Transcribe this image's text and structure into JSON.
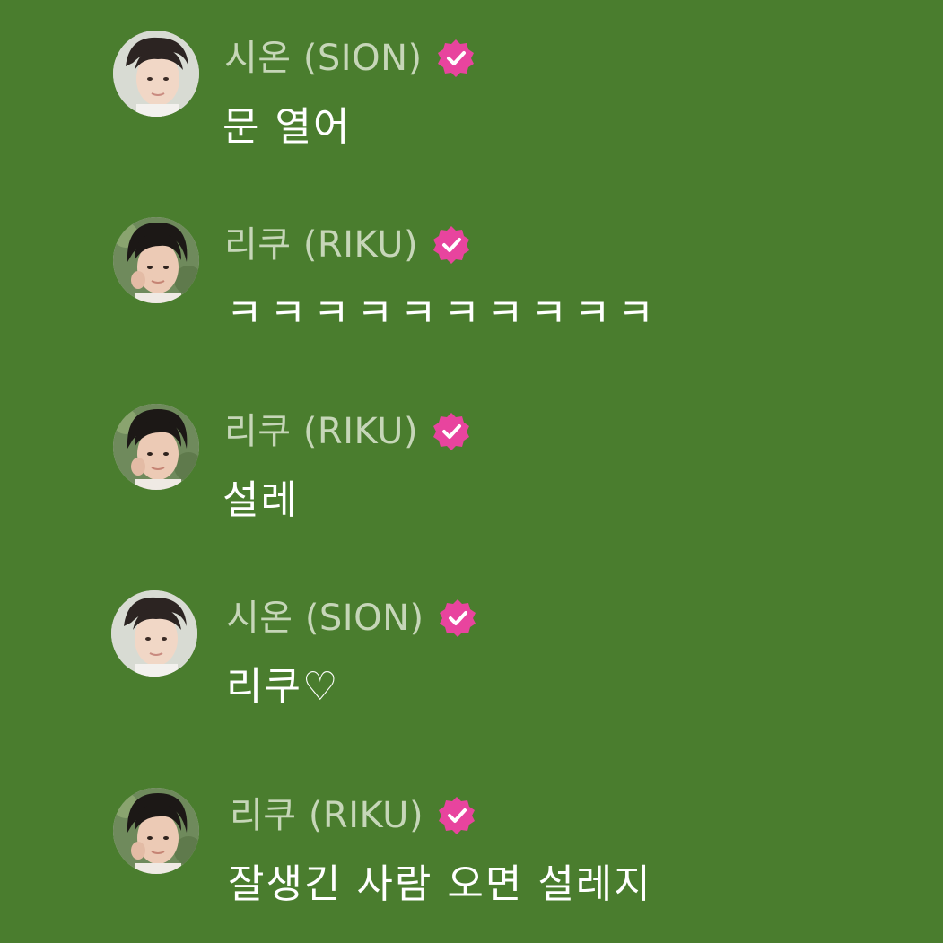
{
  "colors": {
    "background": "#4a7d2e",
    "username": "#c6d6b8",
    "message": "#ffffff",
    "verified_badge": "#e8449e"
  },
  "messages": [
    {
      "avatar": "avatar-sion",
      "username": "시온 (SION)",
      "verified_icon": "verified-badge-icon",
      "text": "문 열어"
    },
    {
      "avatar": "avatar-riku",
      "username": "리쿠 (RIKU)",
      "verified_icon": "verified-badge-icon",
      "text": "ㅋㅋㅋㅋㅋㅋㅋㅋㅋㅋ"
    },
    {
      "avatar": "avatar-riku",
      "username": "리쿠 (RIKU)",
      "verified_icon": "verified-badge-icon",
      "text": "설레"
    },
    {
      "avatar": "avatar-sion",
      "username": "시온 (SION)",
      "verified_icon": "verified-badge-icon",
      "text": "리쿠♡"
    },
    {
      "avatar": "avatar-riku",
      "username": "리쿠 (RIKU)",
      "verified_icon": "verified-badge-icon",
      "text": "잘생긴 사람 오면 설레지"
    }
  ]
}
